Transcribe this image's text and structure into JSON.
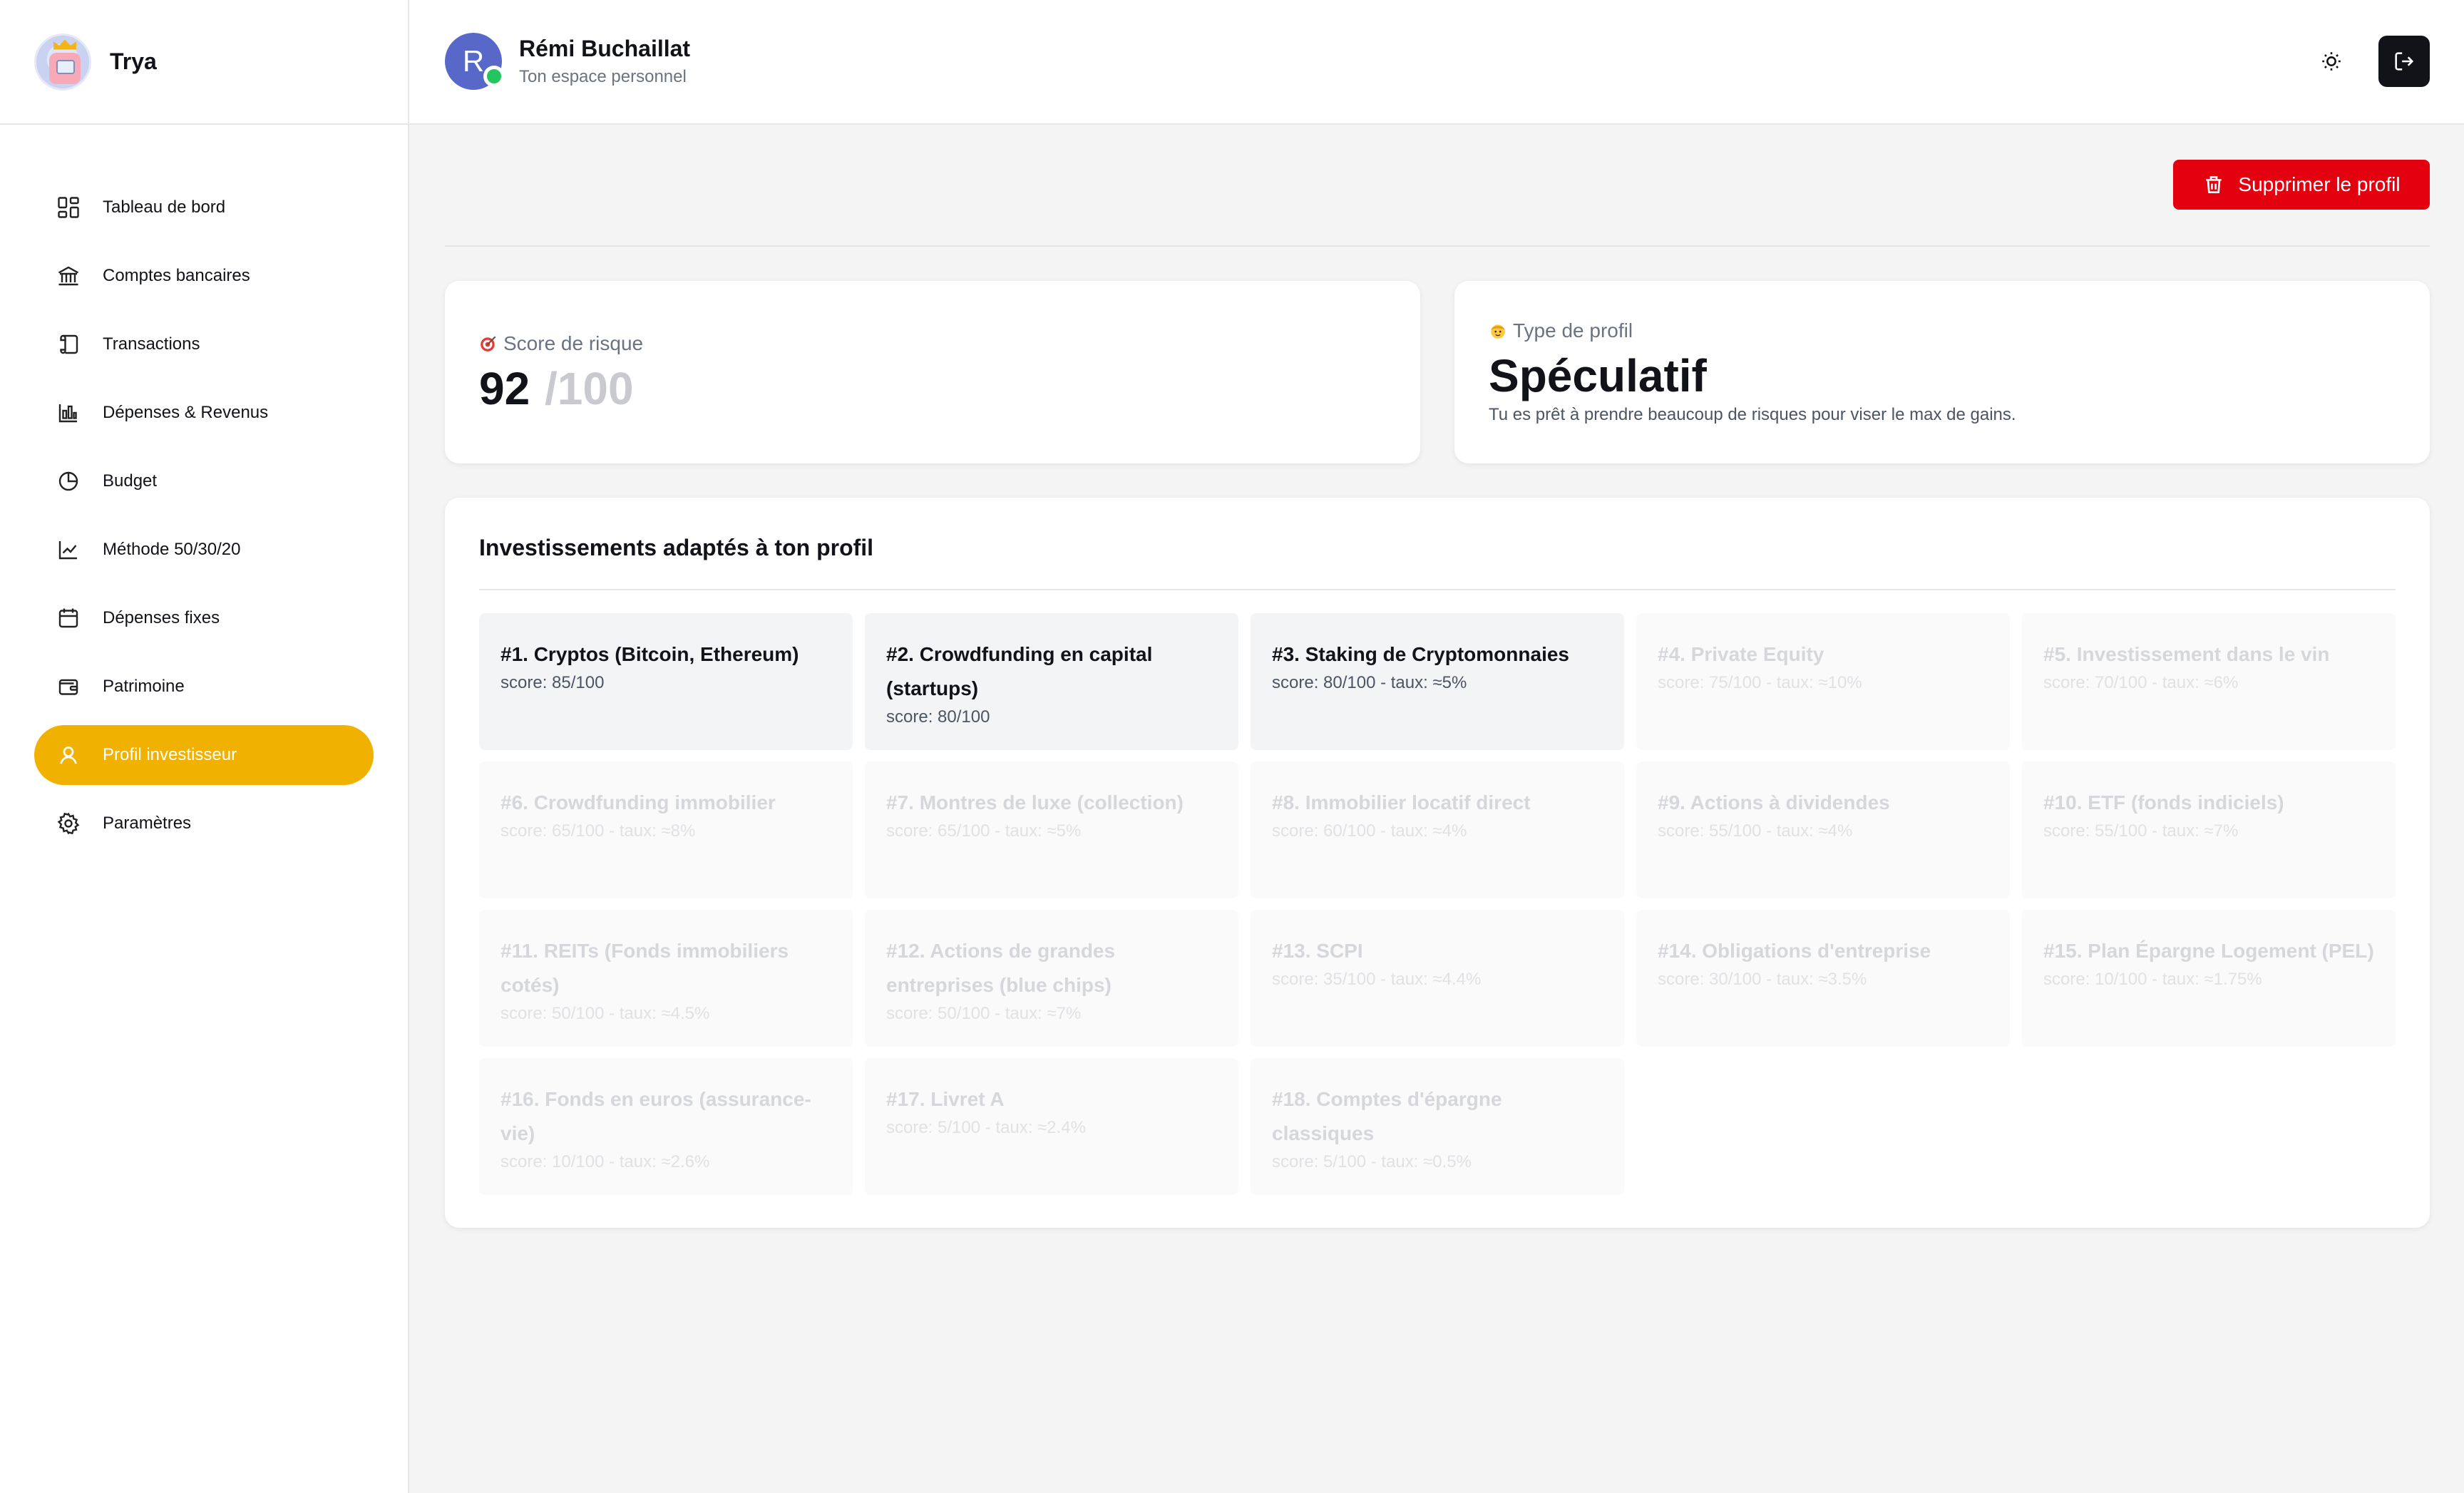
{
  "app": {
    "name": "Trya"
  },
  "nav": [
    {
      "label": "Tableau de bord",
      "icon": "dashboard-icon"
    },
    {
      "label": "Comptes bancaires",
      "icon": "bank-icon"
    },
    {
      "label": "Transactions",
      "icon": "scroll-icon"
    },
    {
      "label": "Dépenses & Revenus",
      "icon": "bar-chart-icon"
    },
    {
      "label": "Budget",
      "icon": "pie-chart-icon"
    },
    {
      "label": "Méthode 50/30/20",
      "icon": "line-chart-icon"
    },
    {
      "label": "Dépenses fixes",
      "icon": "calendar-icon"
    },
    {
      "label": "Patrimoine",
      "icon": "wallet-icon"
    },
    {
      "label": "Profil investisseur",
      "icon": "user-icon",
      "active": true
    },
    {
      "label": "Paramètres",
      "icon": "gear-icon"
    }
  ],
  "header": {
    "user_initial": "R",
    "user_name": "Rémi Buchaillat",
    "user_subtitle": "Ton espace personnel",
    "theme_icon": "sun-icon",
    "logout_icon": "logout-icon"
  },
  "actions": {
    "delete_label": "Supprimer le profil",
    "delete_color": "#e3000f"
  },
  "score": {
    "label": "Score de risque",
    "value": "92",
    "max": "/100"
  },
  "profile_type": {
    "label": "Type de profil",
    "value": "Spéculatif",
    "description": "Tu es prêt à prendre beaucoup de risques pour viser le max de gains."
  },
  "investments": {
    "title": "Investissements adaptés à ton profil",
    "items": [
      {
        "name": "#1. Cryptos (Bitcoin, Ethereum)",
        "score": "score: 85/100",
        "highlight": true
      },
      {
        "name": "#2. Crowdfunding en capital (startups)",
        "score": "score: 80/100",
        "highlight": true
      },
      {
        "name": "#3. Staking de Cryptomonnaies",
        "score": "score: 80/100 - taux: ≈5%",
        "highlight": true
      },
      {
        "name": "#4. Private Equity",
        "score": "score: 75/100 - taux: ≈10%",
        "highlight": false
      },
      {
        "name": "#5. Investissement dans le vin",
        "score": "score: 70/100 - taux: ≈6%",
        "highlight": false
      },
      {
        "name": "#6. Crowdfunding immobilier",
        "score": "score: 65/100 - taux: ≈8%",
        "highlight": false
      },
      {
        "name": "#7. Montres de luxe (collection)",
        "score": "score: 65/100 - taux: ≈5%",
        "highlight": false
      },
      {
        "name": "#8. Immobilier locatif direct",
        "score": "score: 60/100 - taux: ≈4%",
        "highlight": false
      },
      {
        "name": "#9. Actions à dividendes",
        "score": "score: 55/100 - taux: ≈4%",
        "highlight": false
      },
      {
        "name": "#10. ETF (fonds indiciels)",
        "score": "score: 55/100 - taux: ≈7%",
        "highlight": false
      },
      {
        "name": "#11. REITs (Fonds immobiliers cotés)",
        "score": "score: 50/100 - taux: ≈4.5%",
        "highlight": false
      },
      {
        "name": "#12. Actions de grandes entreprises (blue chips)",
        "score": "score: 50/100 - taux: ≈7%",
        "highlight": false
      },
      {
        "name": "#13. SCPI",
        "score": "score: 35/100 - taux: ≈4.4%",
        "highlight": false
      },
      {
        "name": "#14. Obligations d'entreprise",
        "score": "score: 30/100 - taux: ≈3.5%",
        "highlight": false
      },
      {
        "name": "#15. Plan Épargne Logement (PEL)",
        "score": "score: 10/100 - taux: ≈1.75%",
        "highlight": false
      },
      {
        "name": "#16. Fonds en euros (assurance-vie)",
        "score": "score: 10/100 - taux: ≈2.6%",
        "highlight": false
      },
      {
        "name": "#17. Livret A",
        "score": "score: 5/100 - taux: ≈2.4%",
        "highlight": false
      },
      {
        "name": "#18. Comptes d'épargne classiques",
        "score": "score: 5/100 - taux: ≈0.5%",
        "highlight": false
      }
    ]
  },
  "colors": {
    "accent": "#f1b100",
    "danger": "#e3000f",
    "online": "#22c55e",
    "avatar": "#5868c8"
  }
}
